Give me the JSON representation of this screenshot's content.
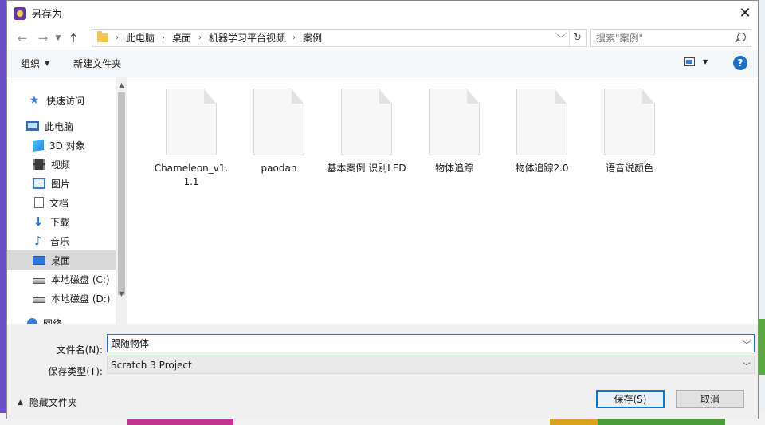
{
  "window": {
    "title": "另存为",
    "close_icon": "close-icon"
  },
  "address": {
    "breadcrumbs": [
      "此电脑",
      "桌面",
      "机器学习平台视频",
      "案例"
    ],
    "search_placeholder": "搜索\"案例\""
  },
  "toolbar": {
    "organize": "组织",
    "new_folder": "新建文件夹",
    "help": "?"
  },
  "nav": {
    "items": [
      {
        "label": "快速访问",
        "icon": "star-icon"
      },
      {
        "label": "此电脑",
        "icon": "computer-icon"
      },
      {
        "label": "3D 对象",
        "icon": "cube-icon"
      },
      {
        "label": "视频",
        "icon": "video-icon"
      },
      {
        "label": "图片",
        "icon": "picture-icon"
      },
      {
        "label": "文档",
        "icon": "document-icon"
      },
      {
        "label": "下载",
        "icon": "download-icon"
      },
      {
        "label": "音乐",
        "icon": "music-icon"
      },
      {
        "label": "桌面",
        "icon": "desktop-icon",
        "selected": true
      },
      {
        "label": "本地磁盘 (C:)",
        "icon": "disk-icon"
      },
      {
        "label": "本地磁盘 (D:)",
        "icon": "disk-icon"
      },
      {
        "label": "网络",
        "icon": "network-icon"
      }
    ]
  },
  "files": [
    {
      "name": "Chameleon_v1.1.1"
    },
    {
      "name": "paodan"
    },
    {
      "name": "基本案例 识别LED"
    },
    {
      "name": "物体追踪"
    },
    {
      "name": "物体追踪2.0"
    },
    {
      "name": "语音说颜色"
    }
  ],
  "form": {
    "filename_label": "文件名(N):",
    "filename_value": "跟随物体",
    "filetype_label": "保存类型(T):",
    "filetype_value": "Scratch 3 Project"
  },
  "footer": {
    "hide_folders": "隐藏文件夹",
    "save": "保存(S)",
    "cancel": "取消"
  }
}
